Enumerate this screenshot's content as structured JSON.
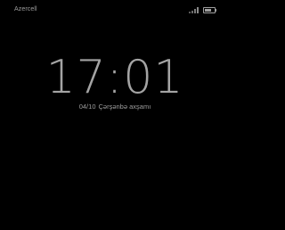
{
  "status_bar": {
    "carrier": "Azercell",
    "signal_icon": "signal-bars-icon",
    "battery_icon": "battery-icon",
    "battery_level": 0.7
  },
  "lock_screen": {
    "time": "17:01",
    "date": "04/10",
    "weekday": "Çərşənbə axşamı"
  },
  "colors": {
    "background": "#000000",
    "text_dim": "#9e9e9e",
    "clock": "#a4a4a4"
  }
}
